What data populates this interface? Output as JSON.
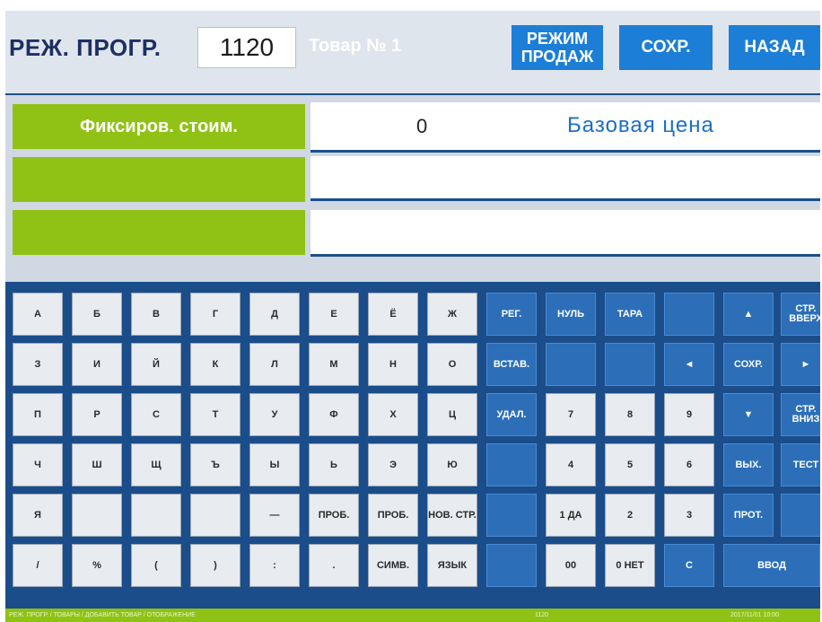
{
  "header": {
    "mode_title": "РЕЖ. ПРОГР.",
    "program_number": "1120",
    "item_label": "Товар № 1",
    "sales_mode_button": "РЕЖИМ ПРОДАЖ",
    "save_button": "СОХР.",
    "back_button": "НАЗАД"
  },
  "fields": {
    "fixed_price_label": "Фиксиров. стоим.",
    "value": "0",
    "base_price_label": "Базовая цена",
    "label2": "",
    "label3": ""
  },
  "keypad": {
    "letters": [
      [
        "А",
        "Б",
        "В",
        "Г",
        "Д",
        "Е",
        "Ё",
        "Ж"
      ],
      [
        "З",
        "И",
        "Й",
        "К",
        "Л",
        "М",
        "Н",
        "О"
      ],
      [
        "П",
        "Р",
        "С",
        "Т",
        "У",
        "Ф",
        "Х",
        "Ц"
      ],
      [
        "Ч",
        "Ш",
        "Щ",
        "Ъ",
        "Ы",
        "Ь",
        "Э",
        "Ю"
      ],
      [
        "Я",
        "",
        "",
        "",
        "—",
        "ПРОБ.",
        "ПРОБ.",
        "НОВ. СТР."
      ],
      [
        "/",
        "%",
        "(",
        ")",
        ":",
        ".",
        "СИМВ.",
        "ЯЗЫК"
      ]
    ],
    "functions": [
      [
        "РЕГ.",
        "НУЛЬ",
        "ТАРА",
        "",
        "▲",
        "СТР. ВВЕРХ"
      ],
      [
        "ВСТАВ.",
        "",
        "",
        "◄",
        "СОХР.",
        "►"
      ],
      [
        "УДАЛ.",
        "7",
        "8",
        "9",
        "▼",
        "СТР. ВНИЗ"
      ],
      [
        "",
        "4",
        "5",
        "6",
        "ВЫХ.",
        "ТЕСТ"
      ],
      [
        "",
        "1 ДА",
        "2",
        "3",
        "ПРОТ.",
        ""
      ],
      [
        "",
        "00",
        "0 НЕТ",
        "С",
        "ВВОД",
        ""
      ]
    ]
  },
  "statusbar": {
    "left": "РЕЖ. ПРОГР. / ТОВАРЫ / ДОБАВИТЬ ТОВАР / ОТОБРАЖЕНИЕ",
    "middle": "1120",
    "right": "2017/11/01 10:00"
  },
  "colors": {
    "accent_green": "#8fc214",
    "button_blue": "#1c7ed6",
    "key_blue": "#2c6fb8",
    "background_navy": "#0d3f7a"
  }
}
